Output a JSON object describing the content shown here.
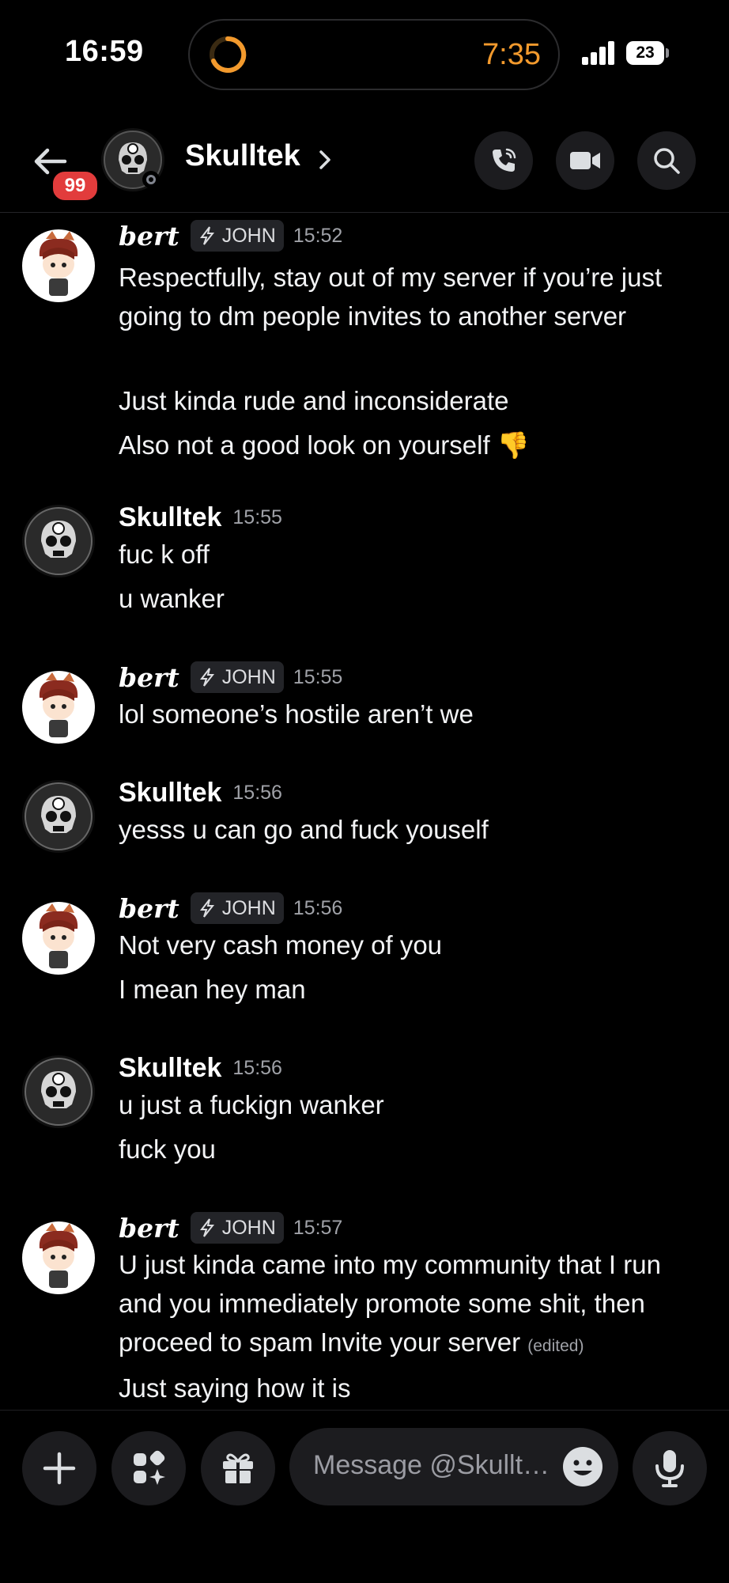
{
  "status_bar": {
    "time": "16:59",
    "activity_timer": "7:35",
    "battery": "23",
    "accent": "#f39a2d"
  },
  "header": {
    "unread_badge": "99",
    "channel_name": "Skulltek",
    "icons": [
      "back-arrow-icon",
      "phone-icon",
      "video-camera-icon",
      "search-icon"
    ]
  },
  "messages": [
    {
      "author": "bert",
      "tag": "JOHN",
      "time": "15:52",
      "lines": [
        "Respectfully, stay out of my server if you’re just going to dm people invites to another server",
        "Just kinda rude and inconsiderate",
        "Also not a good look on yourself 👎"
      ]
    },
    {
      "author": "Skulltek",
      "time": "15:55",
      "lines": [
        "fuc k off",
        "u wanker"
      ]
    },
    {
      "author": "bert",
      "tag": "JOHN",
      "time": "15:55",
      "lines": [
        "lol someone’s hostile aren’t we"
      ]
    },
    {
      "author": "Skulltek",
      "time": "15:56",
      "lines": [
        "yesss  u can go and fuck youself"
      ]
    },
    {
      "author": "bert",
      "tag": "JOHN",
      "time": "15:56",
      "lines": [
        "Not very cash money of you",
        "I mean hey man"
      ]
    },
    {
      "author": "Skulltek",
      "time": "15:56",
      "lines": [
        "u just a fuckign wanker",
        "fuck you"
      ]
    },
    {
      "author": "bert",
      "tag": "JOHN",
      "time": "15:57",
      "lines": [
        "U just kinda came into my community that I run and you immediately promote some shit, then proceed to spam Invite your server",
        "Just saying how it is"
      ],
      "edited_label": "(edited)"
    }
  ],
  "composer": {
    "placeholder": "Message @Skullt…",
    "icons": [
      "plus-icon",
      "apps-icon",
      "gift-icon",
      "emoji-icon",
      "microphone-icon"
    ]
  }
}
